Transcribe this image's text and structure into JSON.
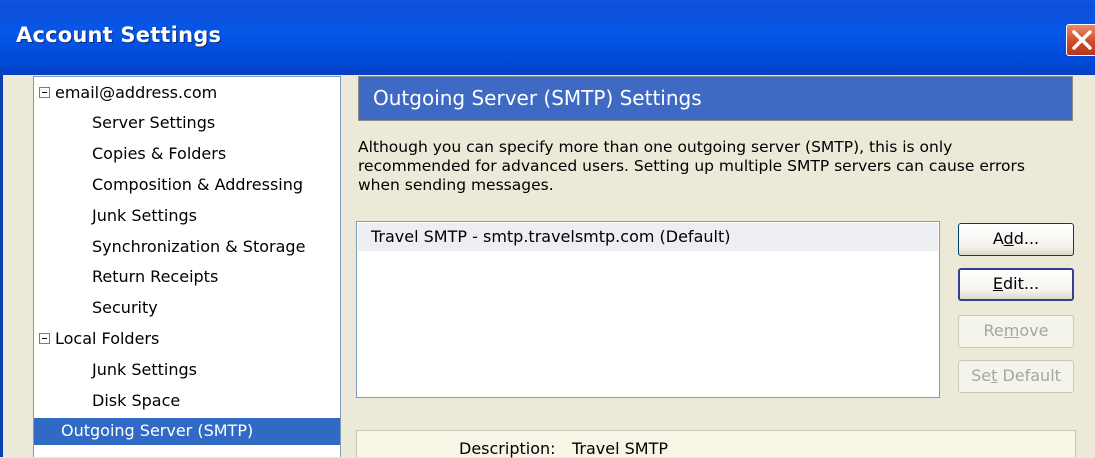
{
  "window": {
    "title": "Account Settings",
    "close_icon": "close-icon"
  },
  "tree": {
    "account": "email@address.com",
    "account_items": [
      "Server Settings",
      "Copies & Folders",
      "Composition & Addressing",
      "Junk Settings",
      "Synchronization & Storage",
      "Return Receipts",
      "Security"
    ],
    "local": "Local Folders",
    "local_items": [
      "Junk Settings",
      "Disk Space"
    ],
    "outgoing": "Outgoing Server (SMTP)"
  },
  "panel": {
    "heading": "Outgoing Server (SMTP) Settings",
    "description_lines": [
      "Although you can specify more than one outgoing server (SMTP), this is only",
      "recommended for advanced users. Setting up multiple SMTP servers can cause errors",
      "when sending messages."
    ],
    "servers": [
      "Travel SMTP - smtp.travelsmtp.com (Default)"
    ],
    "buttons": {
      "add": {
        "pre": "A",
        "key": "d",
        "post": "d..."
      },
      "edit": {
        "pre": "",
        "key": "E",
        "post": "dit..."
      },
      "remove": {
        "pre": "Re",
        "key": "m",
        "post": "ove"
      },
      "set_default": {
        "pre": "Se",
        "key": "t",
        "post": " Default"
      }
    },
    "details": {
      "description_label": "Description:",
      "description_value": "Travel SMTP"
    }
  }
}
